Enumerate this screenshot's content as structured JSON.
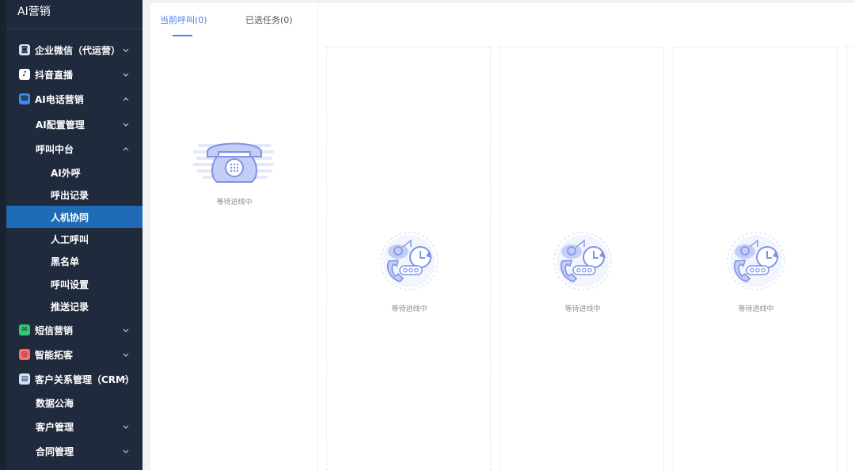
{
  "sidebar": {
    "brand": "AI营销",
    "items": [
      {
        "label": "企业微信（代运营）",
        "level": 1,
        "icon": "wechat-work-icon",
        "chevron": "down"
      },
      {
        "label": "抖音直播",
        "level": 1,
        "icon": "douyin-icon",
        "chevron": "down"
      },
      {
        "label": "AI电话营销",
        "level": 1,
        "icon": "ai-phone-icon",
        "chevron": "up"
      },
      {
        "label": "AI配置管理",
        "level": 2,
        "chevron": "down"
      },
      {
        "label": "呼叫中台",
        "level": 2,
        "chevron": "up"
      },
      {
        "label": "AI外呼",
        "level": 3
      },
      {
        "label": "呼出记录",
        "level": 3
      },
      {
        "label": "人机协同",
        "level": 3,
        "active": true
      },
      {
        "label": "人工呼叫",
        "level": 3
      },
      {
        "label": "黑名单",
        "level": 3
      },
      {
        "label": "呼叫设置",
        "level": 3
      },
      {
        "label": "推送记录",
        "level": 3
      },
      {
        "label": "短信营销",
        "level": 1,
        "icon": "sms-icon",
        "chevron": "down"
      },
      {
        "label": "智能拓客",
        "level": 1,
        "icon": "target-icon",
        "chevron": "down"
      },
      {
        "label": "客户关系管理（CRM）",
        "level": 1,
        "icon": "crm-icon",
        "chevron": "up"
      },
      {
        "label": "数据公海",
        "level": 2
      },
      {
        "label": "客户管理",
        "level": 2,
        "chevron": "down"
      },
      {
        "label": "合同管理",
        "level": 2,
        "chevron": "down"
      }
    ],
    "colors": {
      "background": "#1f2a3d",
      "active": "#1f6bb5"
    }
  },
  "main": {
    "tabs": [
      {
        "label": "当前呼叫(0)",
        "active": true
      },
      {
        "label": "已选任务(0)",
        "active": false
      }
    ],
    "current_call_status": "等待进线中",
    "slots": [
      {
        "status": "等待进线中"
      },
      {
        "status": "等待进线中"
      },
      {
        "status": "等待进线中"
      }
    ],
    "colors": {
      "accent": "#4a7ee8",
      "icon": "#a9b8f0"
    }
  }
}
